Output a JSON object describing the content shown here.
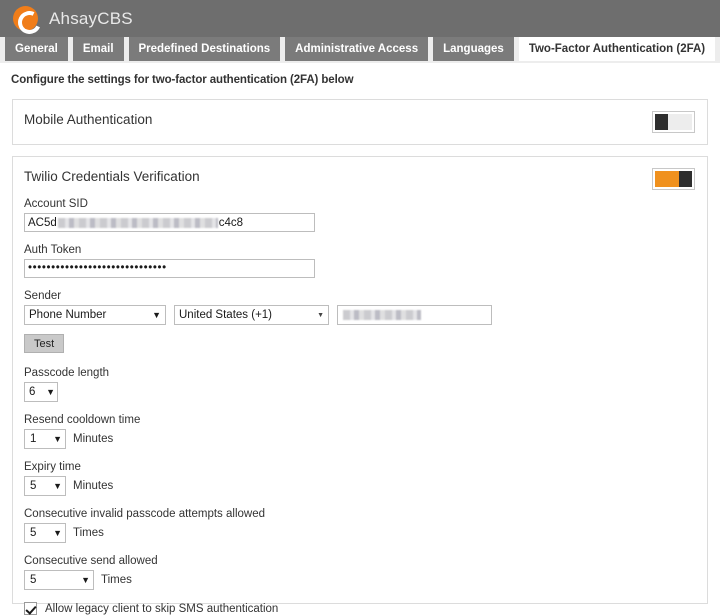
{
  "header": {
    "logo_icon": "ahsay-c-logo-icon",
    "brand": "AhsayCBS",
    "bg_color": "#6e6e6e",
    "accent_color": "#f07d19"
  },
  "tabs": [
    {
      "label": "General",
      "active": false
    },
    {
      "label": "Email",
      "active": false
    },
    {
      "label": "Predefined Destinations",
      "active": false
    },
    {
      "label": "Administrative Access",
      "active": false
    },
    {
      "label": "Languages",
      "active": false
    },
    {
      "label": "Two-Factor Authentication (2FA)",
      "active": true
    }
  ],
  "description": "Configure the settings for two-factor authentication (2FA) below",
  "mobile_auth": {
    "title": "Mobile Authentication",
    "toggle_state": "off"
  },
  "twilio": {
    "title": "Twilio Credentials Verification",
    "toggle_state": "on",
    "account_sid": {
      "label": "Account SID",
      "value_prefix": "AC5d",
      "value_suffix": "c4c8",
      "redacted": true
    },
    "auth_token": {
      "label": "Auth Token",
      "value": "••••••••••••••••••••••••••••••"
    },
    "sender": {
      "label": "Sender",
      "type_value": "Phone Number",
      "country_value": "United States (+1)",
      "number_value": "",
      "number_redacted": true
    },
    "test_button": "Test",
    "passcode_length": {
      "label": "Passcode length",
      "value": "6"
    },
    "resend_cooldown": {
      "label": "Resend cooldown time",
      "value": "1",
      "unit": "Minutes"
    },
    "expiry_time": {
      "label": "Expiry time",
      "value": "5",
      "unit": "Minutes"
    },
    "invalid_attempts": {
      "label": "Consecutive invalid passcode attempts allowed",
      "value": "5",
      "unit": "Times"
    },
    "consecutive_send": {
      "label": "Consecutive send allowed",
      "value": "5",
      "unit": "Times"
    },
    "legacy_checkbox": {
      "label": "Allow legacy client to skip SMS authentication",
      "checked": true
    }
  }
}
